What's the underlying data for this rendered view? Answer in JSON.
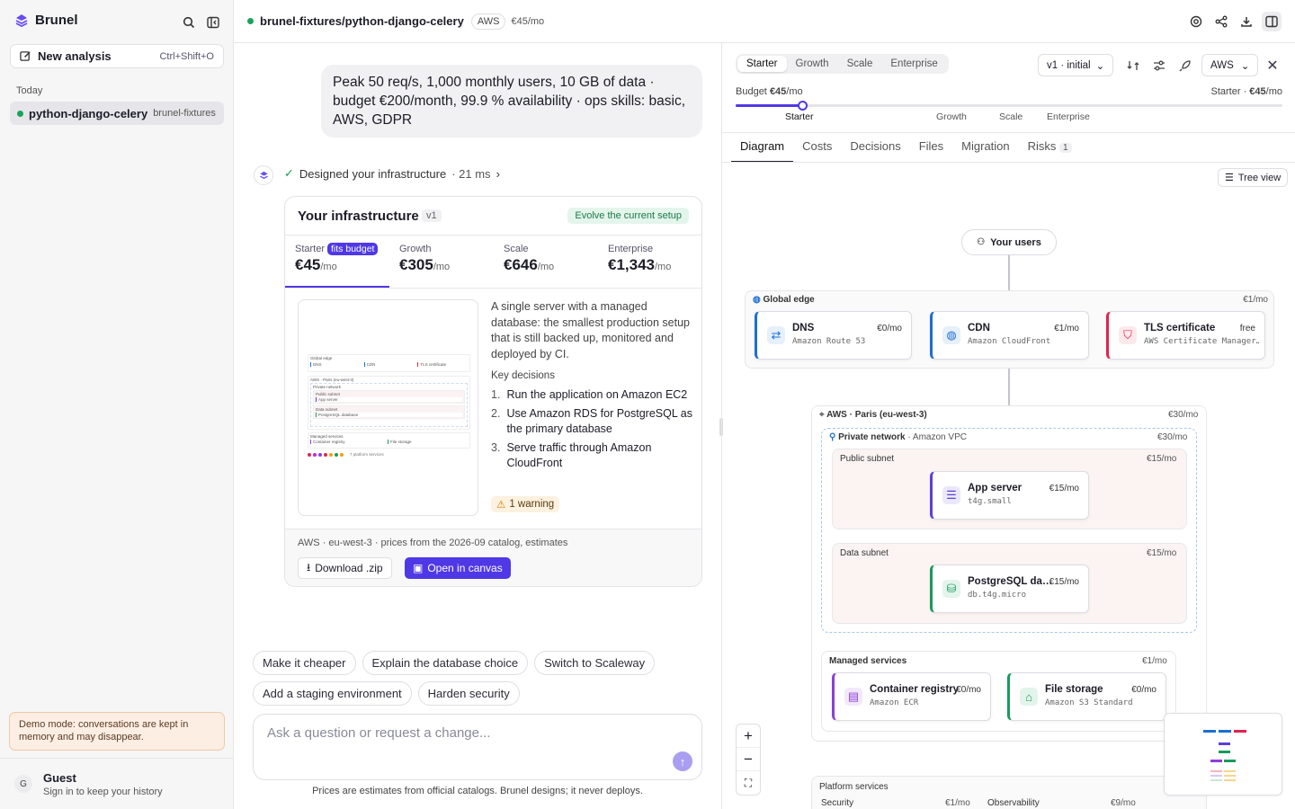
{
  "sidebar": {
    "brand": "Brunel",
    "new_analysis": "New analysis",
    "shortcut": "Ctrl+Shift+O",
    "section": "Today",
    "history": [
      {
        "name": "python-django-celery",
        "org": "brunel-fixtures"
      }
    ],
    "demo_notice": "Demo mode: conversations are kept in memory and may disappear.",
    "user": {
      "initial": "G",
      "name": "Guest",
      "hint": "Sign in to keep your history"
    }
  },
  "header": {
    "repo": "brunel-fixtures/python-django-celery",
    "provider": "AWS",
    "cost": "€45/mo"
  },
  "chat": {
    "user_message": "Peak 50 req/s, 1,000 monthly users, 10 GB of data · budget €200/month, 99.9 % availability · ops skills: basic, AWS, GDPR",
    "status": "Designed your infrastructure",
    "status_time": "· 21 ms",
    "card": {
      "title": "Your infrastructure",
      "version": "v1",
      "evolve": "Evolve the current setup",
      "tiers": [
        {
          "name": "Starter",
          "badge": "fits budget",
          "price": "€45",
          "unit": "/mo"
        },
        {
          "name": "Growth",
          "price": "€305",
          "unit": "/mo"
        },
        {
          "name": "Scale",
          "price": "€646",
          "unit": "/mo"
        },
        {
          "name": "Enterprise",
          "price": "€1,343",
          "unit": "/mo"
        }
      ],
      "description": "A single server with a managed database: the smallest production setup that is still backed up, monitored and deployed by CI.",
      "key_decisions_title": "Key decisions",
      "decisions": [
        "Run the application on Amazon EC2",
        "Use Amazon RDS for PostgreSQL as the primary database",
        "Serve traffic through Amazon CloudFront"
      ],
      "warning": "1 warning",
      "thumb": {
        "global": "Global edge",
        "dns": "DNS",
        "cdn": "CDN",
        "tls": "TLS certificate",
        "region": "AWS · Paris (eu-west-3)",
        "private": "Private network",
        "public": "Public subnet",
        "app": "App server",
        "data": "Data subnet",
        "db": "PostgreSQL database",
        "managed": "Managed services",
        "registry": "Container registry",
        "storage": "File storage",
        "platform": "7 platform services"
      },
      "footnote": "AWS · eu-west-3 · prices from the 2026-09 catalog, estimates",
      "download": "Download .zip",
      "open": "Open in canvas"
    },
    "suggestions": [
      "Make it cheaper",
      "Explain the database choice",
      "Switch to Scaleway",
      "Add a staging environment",
      "Harden security"
    ],
    "placeholder": "Ask a question or request a change...",
    "disclaimer": "Prices are estimates from official catalogs. Brunel designs; it never deploys."
  },
  "canvas": {
    "tiers": [
      "Starter",
      "Growth",
      "Scale",
      "Enterprise"
    ],
    "active_tier": "Starter",
    "version": "v1 · initial",
    "provider": "AWS",
    "budget_label": "Budget",
    "budget_value": "€45",
    "budget_unit": "/mo",
    "budget_right_tier": "Starter ·",
    "budget_right_value": "€45",
    "budget_right_unit": "/mo",
    "slider_labels": [
      "Starter",
      "Growth",
      "Scale",
      "Enterprise"
    ],
    "tabs": [
      "Diagram",
      "Costs",
      "Decisions",
      "Files",
      "Migration",
      "Risks"
    ],
    "risks_count": "1",
    "tree_view": "Tree view",
    "users": "Your users",
    "global_edge": {
      "label": "Global edge",
      "cost": "€1/mo"
    },
    "dns": {
      "title": "DNS",
      "sub": "Amazon Route 53",
      "cost": "€0/mo"
    },
    "cdn": {
      "title": "CDN",
      "sub": "Amazon CloudFront",
      "cost": "€1/mo"
    },
    "tls": {
      "title": "TLS certificate",
      "sub": "AWS Certificate Manager…",
      "cost": "free"
    },
    "region": {
      "label": "AWS · Paris (eu-west-3)",
      "cost": "€30/mo"
    },
    "private": {
      "label": "Private network",
      "sub": "· Amazon VPC",
      "cost": "€30/mo"
    },
    "public_subnet": {
      "label": "Public subnet",
      "cost": "€15/mo"
    },
    "app": {
      "title": "App server",
      "sub": "t4g.small",
      "cost": "€15/mo"
    },
    "data_subnet": {
      "label": "Data subnet",
      "cost": "€15/mo"
    },
    "db": {
      "title": "PostgreSQL da…",
      "sub": "db.t4g.micro",
      "cost": "€15/mo"
    },
    "managed": {
      "label": "Managed services",
      "cost": "€1/mo"
    },
    "registry": {
      "title": "Container registry",
      "sub": "Amazon ECR",
      "cost": "€0/mo"
    },
    "storage": {
      "title": "File storage",
      "sub": "Amazon S3 Standard",
      "cost": "€0/mo"
    },
    "platform": {
      "label": "Platform services",
      "security": "Security",
      "security_cost": "€1/mo",
      "observability": "Observability",
      "observability_cost": "€9/mo"
    },
    "colors": {
      "accent": "#4f38e6",
      "dns": "#1c6fd1",
      "cdn": "#1c6fd1",
      "tls": "#e0234e",
      "app": "#5b3fd6",
      "db": "#1a9a5c",
      "registry": "#8b3fd6",
      "storage": "#1a9a5c"
    }
  }
}
